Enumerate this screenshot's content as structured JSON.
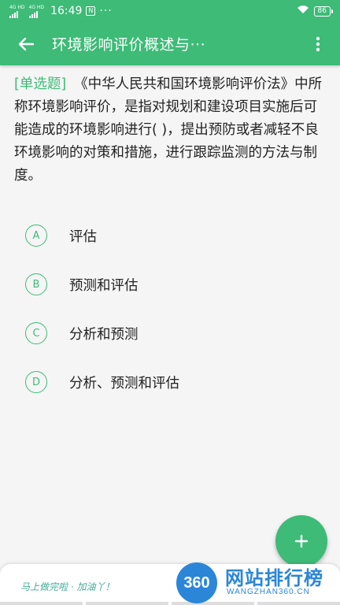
{
  "status_bar": {
    "network_1": "4G HD",
    "network_2": "4G HD",
    "time": "16:49",
    "nfc": "N",
    "more_dots": "···",
    "battery": "86"
  },
  "toolbar": {
    "title": "环境影响评价概述与···"
  },
  "question": {
    "type_label": "[单选题]",
    "text": "《中华人民共和国环境影响评价法》中所称环境影响评价，是指对规划和建设项目实施后可能造成的环境影响进行(  )，提出预防或者减轻不良环境影响的对策和措施，进行跟踪监测的方法与制度。"
  },
  "options": [
    {
      "letter": "A",
      "text": "评估"
    },
    {
      "letter": "B",
      "text": "预测和评估"
    },
    {
      "letter": "C",
      "text": "分析和预测"
    },
    {
      "letter": "D",
      "text": "分析、预测和评估"
    }
  ],
  "fab": {
    "icon": "plus-icon",
    "label": "+"
  },
  "bottom_bar": {
    "encourage_text": "马上做完啦 · 加油丫！"
  },
  "watermark": {
    "logo": "360",
    "cn": "网站排行榜",
    "en": "WANGZHAN360.CN"
  },
  "colors": {
    "primary": "#3dbb77",
    "text": "#222222",
    "background": "#f5f5f5"
  }
}
